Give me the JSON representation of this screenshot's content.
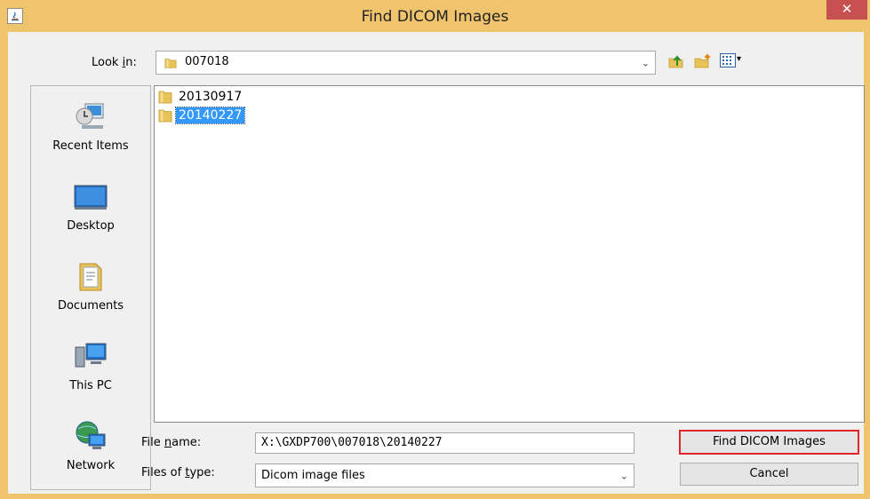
{
  "window": {
    "title": "Find DICOM Images",
    "close_glyph": "✕"
  },
  "look_in": {
    "label_pre": "Look ",
    "label_mnemonic": "i",
    "label_post": "n:",
    "value": "007018",
    "dropdown_arrow": "⌄"
  },
  "toolbar": {
    "icons": [
      "up-one-level-icon",
      "create-new-folder-icon",
      "view-menu-icon"
    ],
    "view_menu_arrow": "▾"
  },
  "sidebar": {
    "items": [
      {
        "label": "Recent Items",
        "icon": "recent-items-icon"
      },
      {
        "label": "Desktop",
        "icon": "desktop-icon"
      },
      {
        "label": "Documents",
        "icon": "documents-icon"
      },
      {
        "label": "This PC",
        "icon": "this-pc-icon"
      },
      {
        "label": "Network",
        "icon": "network-icon"
      }
    ]
  },
  "files": [
    {
      "name": "20130917",
      "selected": false
    },
    {
      "name": "20140227",
      "selected": true
    }
  ],
  "file_name": {
    "label_pre": "File ",
    "label_mnemonic": "n",
    "label_post": "ame:",
    "value": "X:\\GXDP700\\007018\\20140227"
  },
  "file_type": {
    "label_pre": "Files of ",
    "label_mnemonic": "t",
    "label_post": "ype:",
    "value": "Dicom image files",
    "dropdown_arrow": "⌄"
  },
  "buttons": {
    "primary": "Find DICOM Images",
    "cancel": "Cancel"
  },
  "colors": {
    "titlebar": "#f0c36d",
    "close": "#c75050",
    "selection": "#3399ff",
    "primary_outline": "#e0242c"
  }
}
